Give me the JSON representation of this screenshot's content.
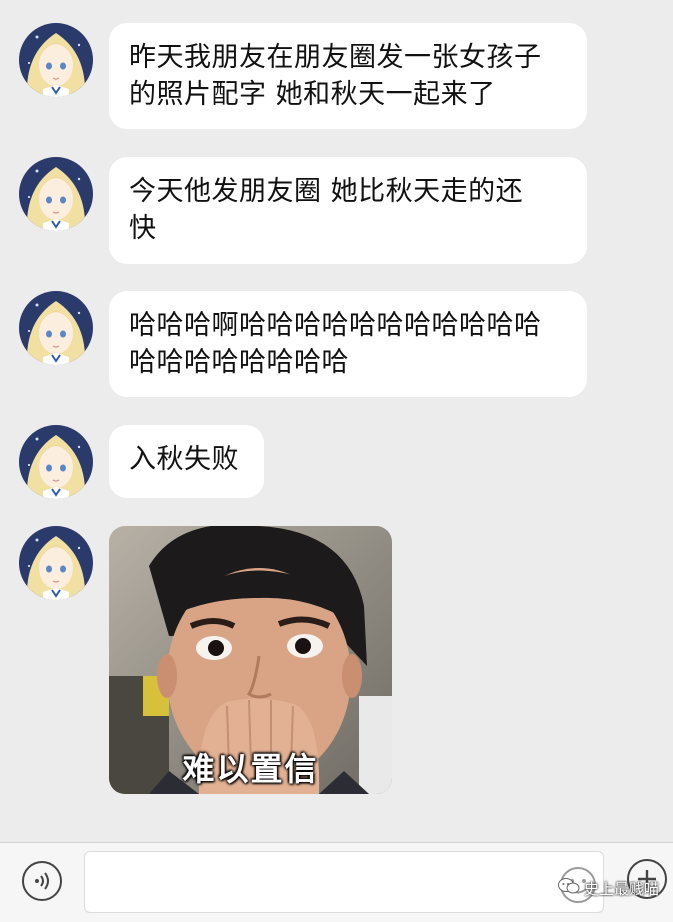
{
  "messages": [
    {
      "type": "text",
      "lines": [
        "昨天我朋友在朋友圈发一张女孩子",
        "的照片配字 她和秋天一起来了"
      ]
    },
    {
      "type": "text",
      "lines": [
        "今天他发朋友圈 她比秋天走的还",
        "快"
      ]
    },
    {
      "type": "text",
      "lines": [
        "哈哈哈啊哈哈哈哈哈哈哈哈哈哈哈",
        "哈哈哈哈哈哈哈哈"
      ]
    },
    {
      "type": "text",
      "lines": [
        "入秋失败"
      ]
    },
    {
      "type": "sticker",
      "caption": "难以置信"
    }
  ],
  "input_bar": {
    "voice_icon": "voice-icon",
    "emoji_icon": "emoji-icon",
    "plus_icon": "plus-icon"
  },
  "watermark": {
    "text": "史上最贱喵"
  },
  "colors": {
    "background": "#ececec",
    "bubble": "#ffffff",
    "input_bar": "#f6f6f6"
  }
}
